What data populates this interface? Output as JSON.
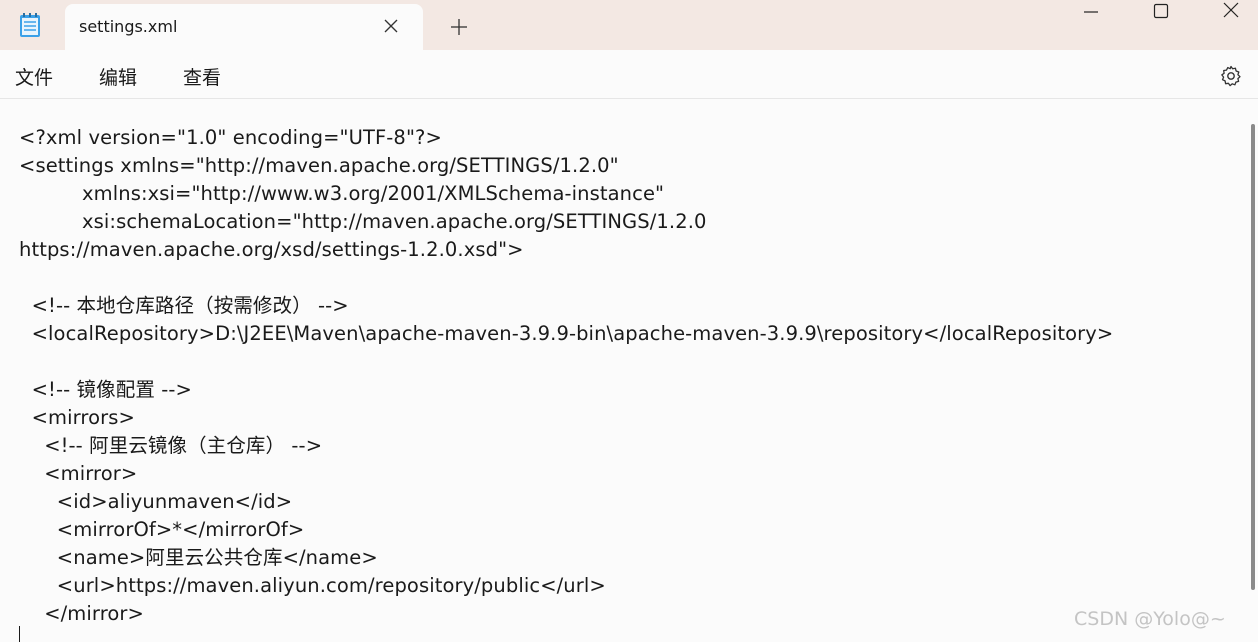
{
  "tab": {
    "title": "settings.xml",
    "close_icon": "close-icon",
    "new_tab_icon": "plus-icon"
  },
  "window_controls": {
    "minimize": "minimize-icon",
    "maximize": "maximize-icon",
    "close": "close-icon"
  },
  "menu": {
    "file": "文件",
    "edit": "编辑",
    "view": "查看",
    "settings_icon": "gear-icon"
  },
  "editor": {
    "lines": [
      "<?xml version=\"1.0\" encoding=\"UTF-8\"?>",
      "<settings xmlns=\"http://maven.apache.org/SETTINGS/1.2.0\"",
      "          xmlns:xsi=\"http://www.w3.org/2001/XMLSchema-instance\"",
      "          xsi:schemaLocation=\"http://maven.apache.org/SETTINGS/1.2.0",
      "https://maven.apache.org/xsd/settings-1.2.0.xsd\">",
      "",
      "  <!-- 本地仓库路径（按需修改） -->",
      "  <localRepository>D:\\J2EE\\Maven\\apache-maven-3.9.9-bin\\apache-maven-3.9.9\\repository</localRepository>",
      "",
      "  <!-- 镜像配置 -->",
      "  <mirrors>",
      "    <!-- 阿里云镜像（主仓库） -->",
      "    <mirror>",
      "      <id>aliyunmaven</id>",
      "      <mirrorOf>*</mirrorOf>",
      "      <name>阿里云公共仓库</name>",
      "      <url>https://maven.aliyun.com/repository/public</url>",
      "    </mirror>"
    ]
  },
  "watermark": "CSDN @Yolo@~"
}
